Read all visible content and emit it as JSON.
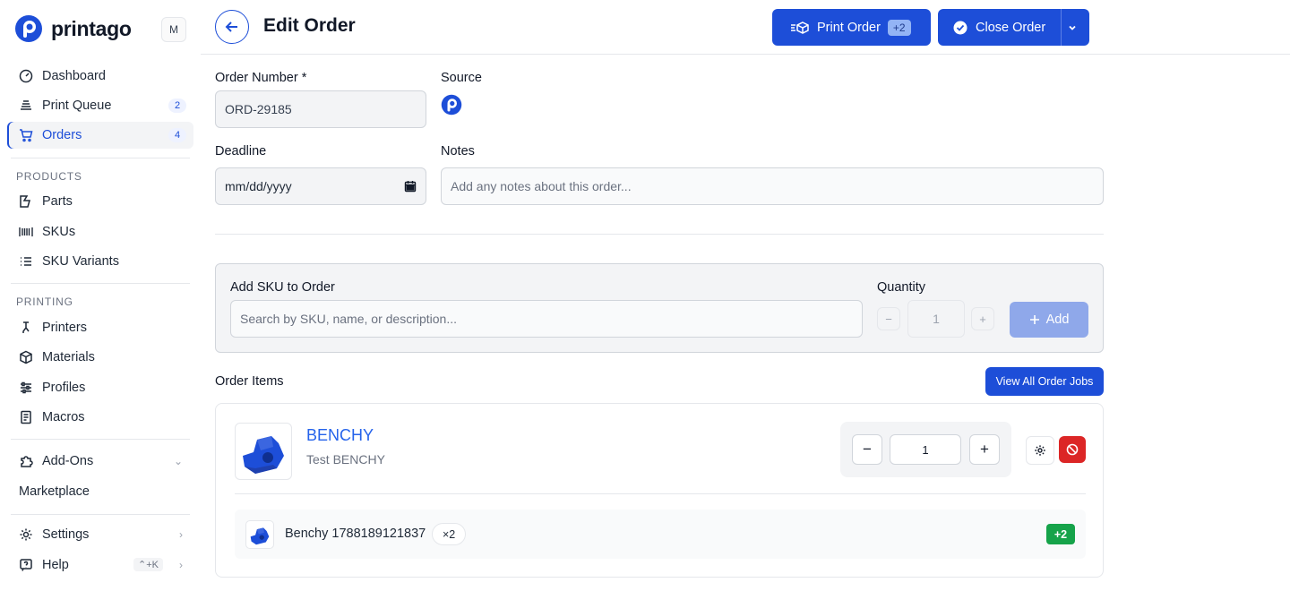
{
  "sidebar": {
    "brand": "printago",
    "avatar_initial": "M",
    "main_items": [
      {
        "label": "Dashboard",
        "icon": "dashboard-icon"
      },
      {
        "label": "Print Queue",
        "icon": "queue-icon",
        "badge": "2"
      },
      {
        "label": "Orders",
        "icon": "cart-icon",
        "badge": "4",
        "active": true
      }
    ],
    "products_label": "PRODUCTS",
    "products_items": [
      {
        "label": "Parts",
        "icon": "parts-icon"
      },
      {
        "label": "SKUs",
        "icon": "barcode-icon"
      },
      {
        "label": "SKU Variants",
        "icon": "list-icon"
      }
    ],
    "printing_label": "PRINTING",
    "printing_items": [
      {
        "label": "Printers",
        "icon": "printer-icon"
      },
      {
        "label": "Materials",
        "icon": "cube-icon"
      },
      {
        "label": "Profiles",
        "icon": "sliders-icon"
      },
      {
        "label": "Macros",
        "icon": "document-icon"
      }
    ],
    "addons_label": "Add-Ons",
    "marketplace_label": "Marketplace",
    "settings_label": "Settings",
    "help_label": "Help",
    "help_shortcut": "⌃+K"
  },
  "header": {
    "title": "Edit Order",
    "print_button": "Print Order",
    "print_count": "+2",
    "close_button": "Close Order"
  },
  "form": {
    "order_number_label": "Order Number *",
    "order_number_value": "ORD-29185",
    "source_label": "Source",
    "deadline_label": "Deadline",
    "deadline_placeholder": "mm/dd/yyyy",
    "notes_label": "Notes",
    "notes_placeholder": "Add any notes about this order..."
  },
  "add_sku": {
    "title": "Add SKU to Order",
    "search_placeholder": "Search by SKU, name, or description...",
    "quantity_label": "Quantity",
    "quantity_value": "1",
    "minus": "−",
    "plus": "+",
    "add_button": "Add"
  },
  "order_items": {
    "title": "Order Items",
    "view_jobs_button": "View All Order Jobs",
    "items": [
      {
        "name": "BENCHY",
        "description": "Test BENCHY",
        "quantity": "1",
        "variant_name": "Benchy 1788189121837",
        "variant_count": "×2",
        "variant_badge": "+2"
      }
    ]
  },
  "colors": {
    "accent": "#1d4ed8",
    "danger": "#dc2626",
    "success": "#16a34a"
  }
}
